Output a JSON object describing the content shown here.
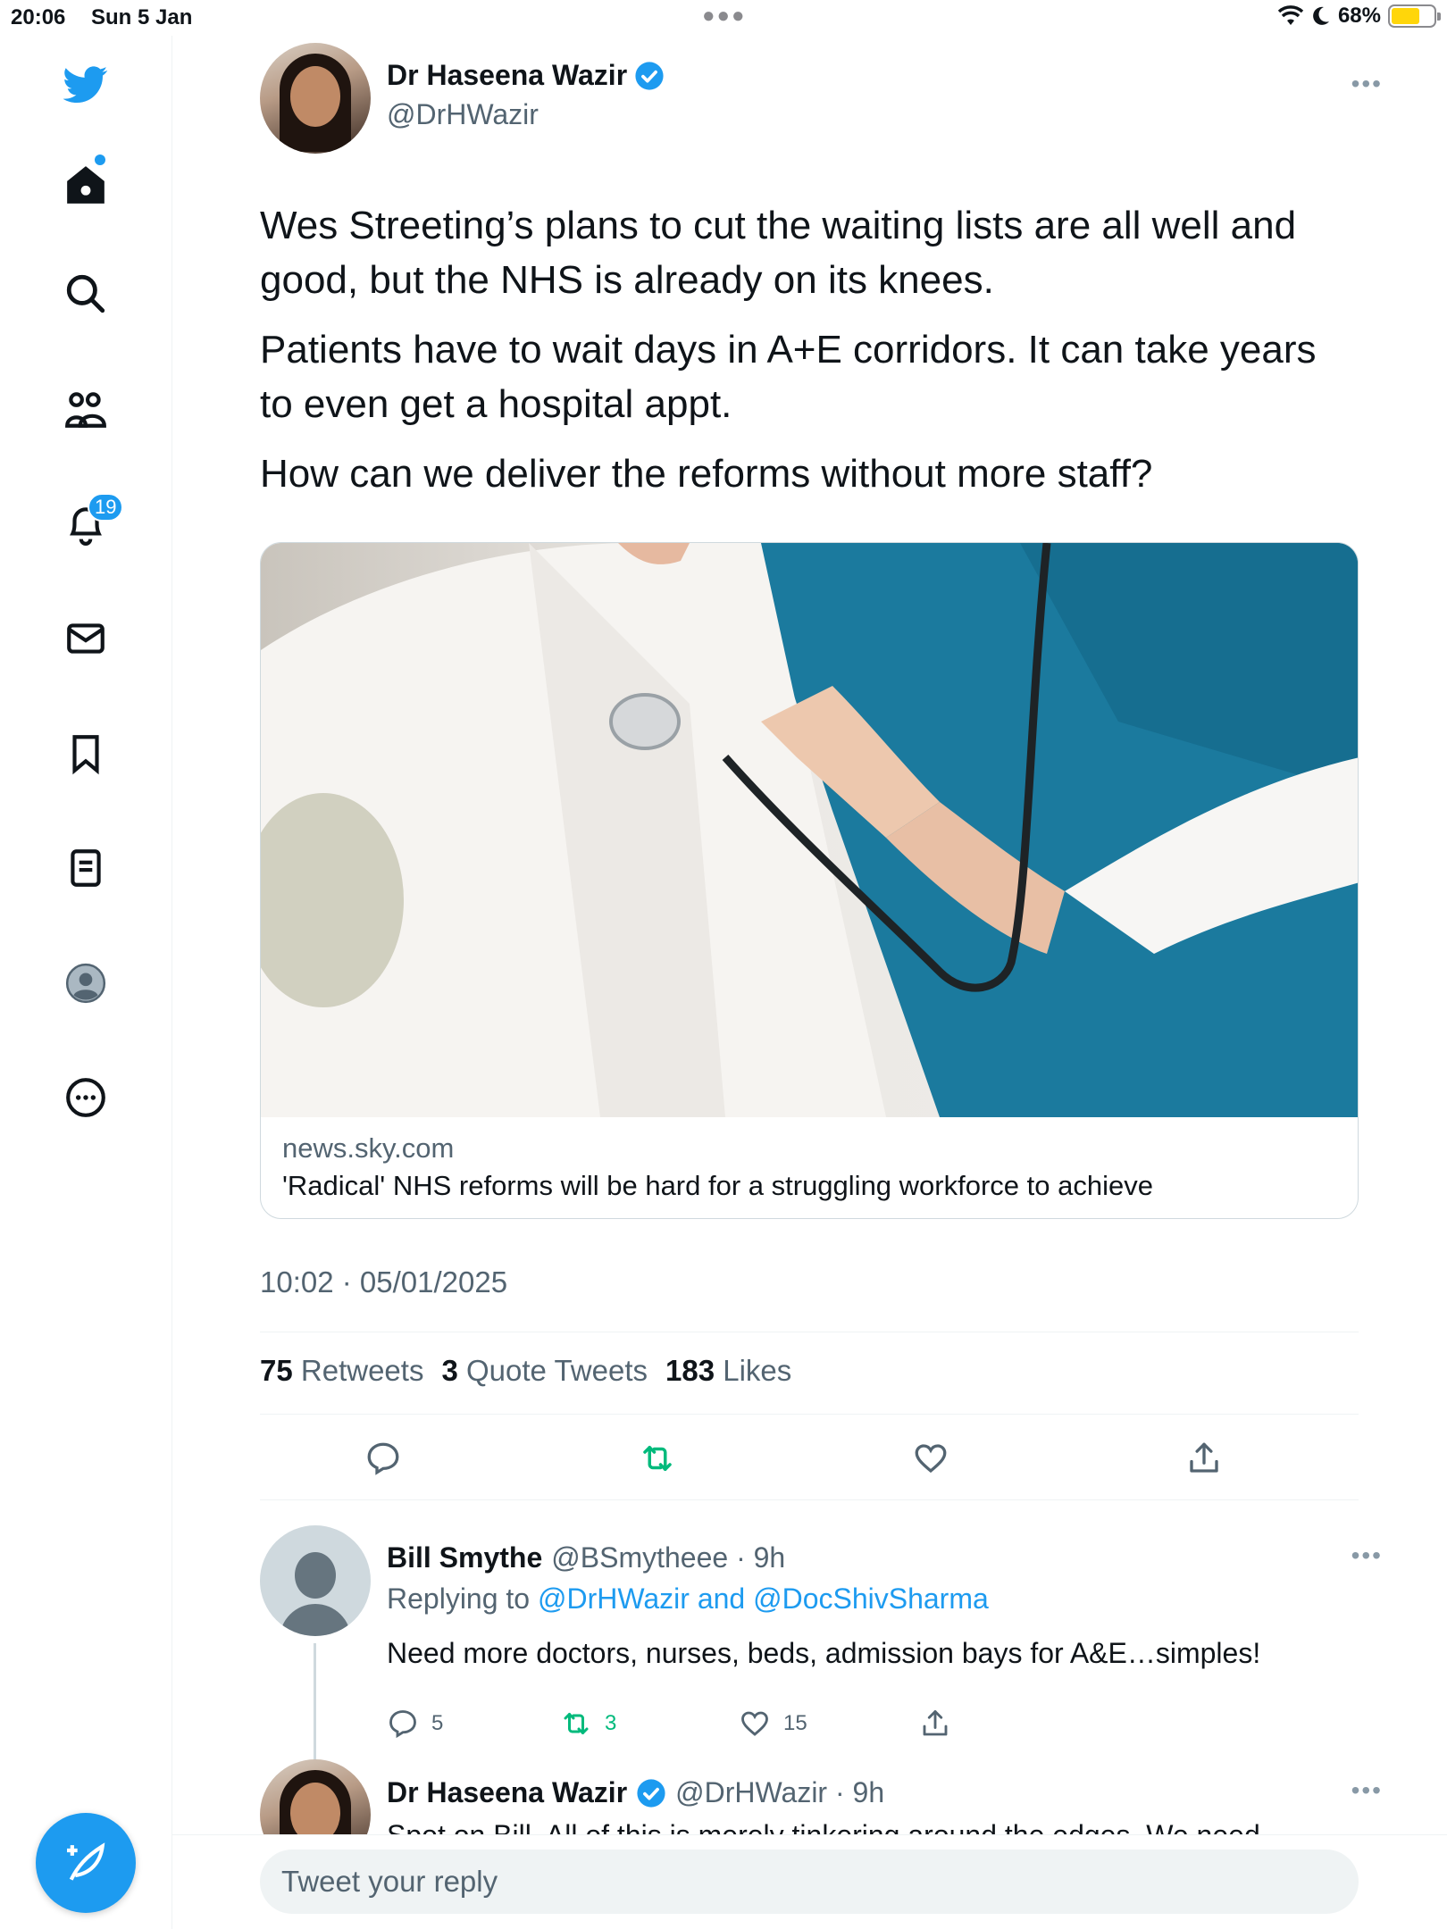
{
  "status_bar": {
    "time": "20:06",
    "date": "Sun 5 Jan",
    "battery": "68%"
  },
  "sidebar": {
    "notifications_badge": "19",
    "items": [
      "twitter-logo",
      "home-icon",
      "search-icon",
      "communities-icon",
      "notifications-icon",
      "messages-icon",
      "bookmarks-icon",
      "lists-icon",
      "profile-icon",
      "more-icon"
    ]
  },
  "tweet": {
    "author_name": "Dr Haseena Wazir",
    "author_handle": "@DrHWazir",
    "paragraphs": [
      "Wes Streeting’s plans to cut the waiting lists are all well and good, but the NHS is already on its knees.",
      "Patients have to wait days in A+E corridors. It can take years to even get a hospital appt.",
      "How can we deliver the reforms without more staff?"
    ],
    "card": {
      "domain": "news.sky.com",
      "title": "'Radical' NHS reforms will be hard for a struggling workforce to achieve"
    },
    "timestamp": "10:02 · 05/01/2025",
    "stats": {
      "retweets_count": "75",
      "retweets_label": "Retweets",
      "quotes_count": "3",
      "quotes_label": "Quote Tweets",
      "likes_count": "183",
      "likes_label": "Likes"
    }
  },
  "replies": [
    {
      "name": "Bill Smythe",
      "handle_time": "@BSmytheee · 9h",
      "replying_prefix": "Replying to ",
      "replying_to": "@DrHWazir and @DocShivSharma",
      "text": "Need more doctors, nurses, beds, admission bays for A&E…simples!",
      "reply_count": "5",
      "retweet_count": "3",
      "like_count": "15"
    },
    {
      "name": "Dr Haseena Wazir",
      "handle_time": "@DrHWazir · 9h",
      "text": "Spot on Bill. All of this is merely tinkering around the edges. We need"
    }
  ],
  "reply_box": {
    "placeholder": "Tweet your reply"
  },
  "colors": {
    "accent": "#1d9bf0",
    "retweet_green": "#00ba7c",
    "text": "#0f1419",
    "secondary": "#536471"
  }
}
